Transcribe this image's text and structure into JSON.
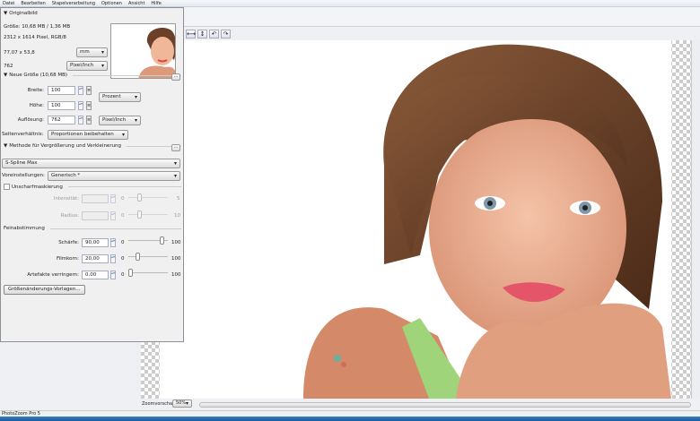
{
  "app": {
    "title": "PhotoZoom Pro 5"
  },
  "menu": [
    "Datei",
    "Bearbeiten",
    "Stapelverarbeitung",
    "Optionen",
    "Ansicht",
    "Hilfe"
  ],
  "toolbar": {
    "icons": [
      "fit-width-icon",
      "fit-height-icon",
      "rotate-left-icon",
      "rotate-right-icon"
    ],
    "glyphs": [
      "⟷",
      "↕",
      "↶",
      "↷"
    ]
  },
  "original": {
    "header": "Originalbild",
    "size": "Größe: 10,68 MB / 1,36 MB",
    "pixels": "2312 x 1614 Pixel, RGB/8",
    "dimensions": "77,07 x 53,8",
    "unit": "mm",
    "resolution": "762",
    "res_unit": "Pixel/Inch"
  },
  "new_size": {
    "header": "Neue Größe (10,68 MB)",
    "width_label": "Breite:",
    "width": "100",
    "height_label": "Höhe:",
    "height": "100",
    "size_unit": "Prozent",
    "res_label": "Auflösung:",
    "resolution": "762",
    "res_unit": "Pixel/Inch",
    "ratio_label": "Seitenverhältnis:",
    "ratio": "Proportionen beibehalten"
  },
  "method": {
    "header": "Methode für Vergrößerung und Verkleinerung",
    "algorithm": "S-Spline Max",
    "preset_label": "Voreinstellungen:",
    "preset": "Generisch *"
  },
  "unsharp": {
    "label": "Unscharfmaskierung",
    "checked": false,
    "intensity_label": "Intensität:",
    "intensity_min": "0",
    "intensity_max": "5",
    "intensity_level": 0.25,
    "radius_label": "Radius:",
    "radius_min": "0",
    "radius_max": "10",
    "radius_level": 0.25
  },
  "fine": {
    "header": "Feinabstimmung",
    "sharp_label": "Schärfe:",
    "sharp": "90,00",
    "sharp_min": "0",
    "sharp_max": "100",
    "sharp_level": 0.9,
    "grain_label": "Filmkorn:",
    "grain": "20,00",
    "grain_min": "0",
    "grain_max": "100",
    "grain_level": 0.2,
    "artifact_label": "Artefakte verringern:",
    "artifact": "0,00",
    "artifact_min": "0",
    "artifact_max": "100",
    "artifact_level": 0
  },
  "presets_button": "Größenänderungs-Vorlagen...",
  "zoom": {
    "label": "Zoomvorschau",
    "value": "50%"
  },
  "status": {
    "text": "PhotoZoom Pro 5"
  }
}
